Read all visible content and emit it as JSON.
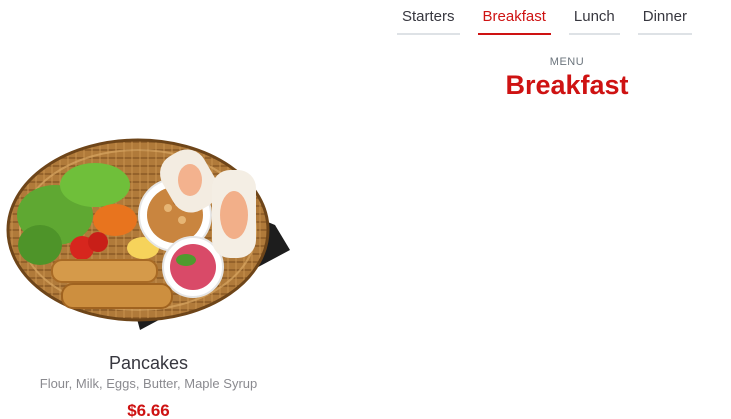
{
  "tabs": [
    {
      "label": "Starters",
      "active": false
    },
    {
      "label": "Breakfast",
      "active": true
    },
    {
      "label": "Lunch",
      "active": false
    },
    {
      "label": "Dinner",
      "active": false
    }
  ],
  "section": {
    "subtitle": "MENU",
    "title": "Breakfast"
  },
  "items": [
    {
      "name": "Pancakes",
      "ingredients": "Flour, Milk, Eggs, Butter, Maple Syrup",
      "price": "$6.66"
    }
  ],
  "colors": {
    "accent": "#ce1212",
    "text": "#37373f",
    "muted": "#8a8a8f"
  }
}
